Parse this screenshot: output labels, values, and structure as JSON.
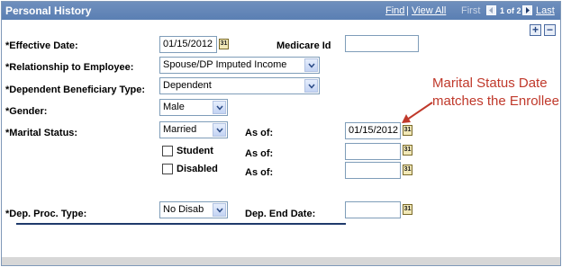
{
  "header": {
    "title": "Personal History",
    "find_label": "Find",
    "separator": "|",
    "view_all_label": "View All",
    "first_label": "First",
    "counter": "1 of 2",
    "last_label": "Last"
  },
  "controls": {
    "add_label": "+",
    "remove_label": "−"
  },
  "form": {
    "effective_date": {
      "label": "*Effective Date:",
      "value": "01/15/2012"
    },
    "medicare_id": {
      "label": "Medicare Id",
      "value": ""
    },
    "relationship": {
      "label": "*Relationship to Employee:",
      "value": "Spouse/DP Imputed Income"
    },
    "dependent_type": {
      "label": "*Dependent Beneficiary Type:",
      "value": "Dependent"
    },
    "gender": {
      "label": "*Gender:",
      "value": "Male"
    },
    "marital_status": {
      "label": "*Marital Status:",
      "value": "Married",
      "as_of_label": "As of:",
      "as_of_value": "01/15/2012"
    },
    "student": {
      "label": "Student",
      "as_of_label": "As of:",
      "as_of_value": ""
    },
    "disabled": {
      "label": "Disabled",
      "as_of_label": "As of:",
      "as_of_value": ""
    },
    "dep_proc_type": {
      "label": "*Dep. Proc. Type:",
      "value": "No Disab"
    },
    "dep_end_date": {
      "label": "Dep. End Date:",
      "value": ""
    }
  },
  "calendar_icon_text": "31",
  "annotation": {
    "line1": "Marital Status Date",
    "line2": "matches the Enrollee"
  },
  "colors": {
    "header_bg": "#5a7fb3",
    "annotation": "#c0392b"
  }
}
